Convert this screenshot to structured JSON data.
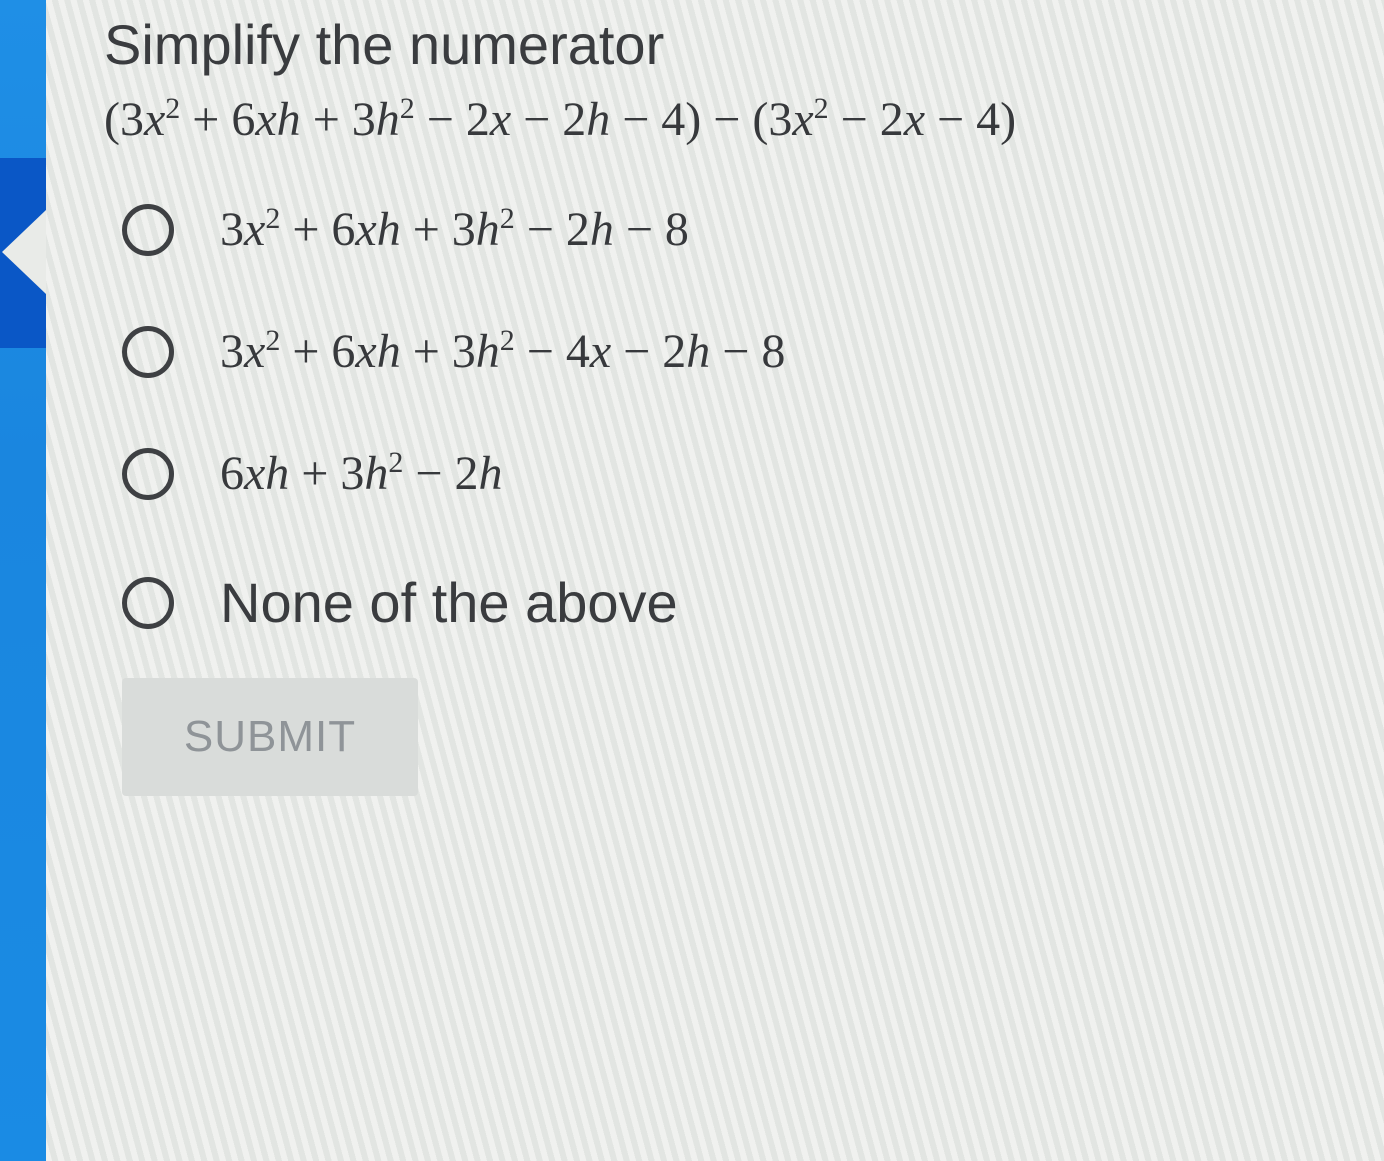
{
  "question": {
    "title": "Simplify the numerator",
    "expression": {
      "p1": "(3",
      "v1": "x",
      "s1": "2",
      "p2": " + 6",
      "v2": "xh",
      "p3": " + 3",
      "v3": "h",
      "s2": "2",
      "p4": " − 2",
      "v4": "x",
      "p5": " − 2",
      "v5": "h",
      "p6": " − 4) − (3",
      "v6": "x",
      "s3": "2",
      "p7": " − 2",
      "v7": "x",
      "p8": " − 4)"
    }
  },
  "options": [
    {
      "p1": "3",
      "v1": "x",
      "s1": "2",
      "p2": " + 6",
      "v2": "xh",
      "p3": " + 3",
      "v3": "h",
      "s2": "2",
      "p4": " − 2",
      "v4": "h",
      "p5": " − 8"
    },
    {
      "p1": "3",
      "v1": "x",
      "s1": "2",
      "p2": " + 6",
      "v2": "xh",
      "p3": " + 3",
      "v3": "h",
      "s2": "2",
      "p4": " − 4",
      "v4": "x",
      "p5": " − 2",
      "v5": "h",
      "p6": " − 8"
    },
    {
      "p1": "6",
      "v1": "xh",
      "p2": " + 3",
      "v2": "h",
      "s1": "2",
      "p3": " − 2",
      "v3": "h"
    },
    {
      "label": "None of the above"
    }
  ],
  "submit": {
    "label": "SUBMIT",
    "enabled": false
  },
  "colors": {
    "sidebar": "#1a86df",
    "sidebar_active": "#0a57c6",
    "background": "#e8eae7",
    "text": "#3a3c3f",
    "button_bg": "#d9dcda",
    "button_text": "#8f9498"
  }
}
